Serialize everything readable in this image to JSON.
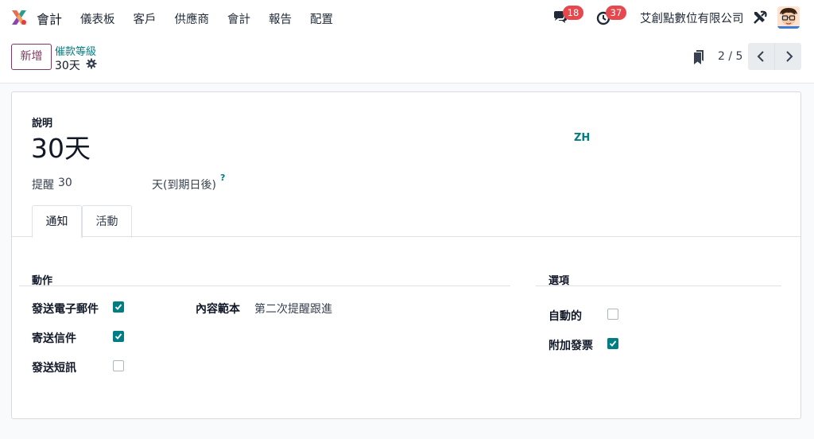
{
  "app": {
    "name": "會計"
  },
  "menu": [
    "儀表板",
    "客戶",
    "供應商",
    "會計",
    "報告",
    "配置"
  ],
  "systray": {
    "messages_count": "18",
    "activities_count": "37",
    "company": "艾創點數位有限公司"
  },
  "control_panel": {
    "new_label": "新增",
    "breadcrumb_parent": "催款等級",
    "record_title": "30天",
    "pager": "2 / 5"
  },
  "form": {
    "description_label": "說明",
    "description_value": "30天",
    "lang_label": "ZH",
    "reminder_label": "提醒",
    "reminder_days": "30",
    "reminder_suffix": "天(到期日後)",
    "help_mark": "?",
    "tabs": [
      {
        "label": "通知",
        "active": true
      },
      {
        "label": "活動",
        "active": false
      }
    ],
    "actions": {
      "title": "動作",
      "send_email_label": "發送電子郵件",
      "send_email": true,
      "send_letter_label": "寄送信件",
      "send_letter": true,
      "send_sms_label": "發送短訊",
      "send_sms": false,
      "template_label": "內容範本",
      "template_value": "第二次提醒跟進"
    },
    "options": {
      "title": "選項",
      "auto_label": "自動的",
      "auto": false,
      "attach_invoice_label": "附加發票",
      "attach_invoice": true
    }
  },
  "colors": {
    "brand": "#7c3a5e",
    "accent": "#017e84",
    "badge": "#e5484d"
  }
}
